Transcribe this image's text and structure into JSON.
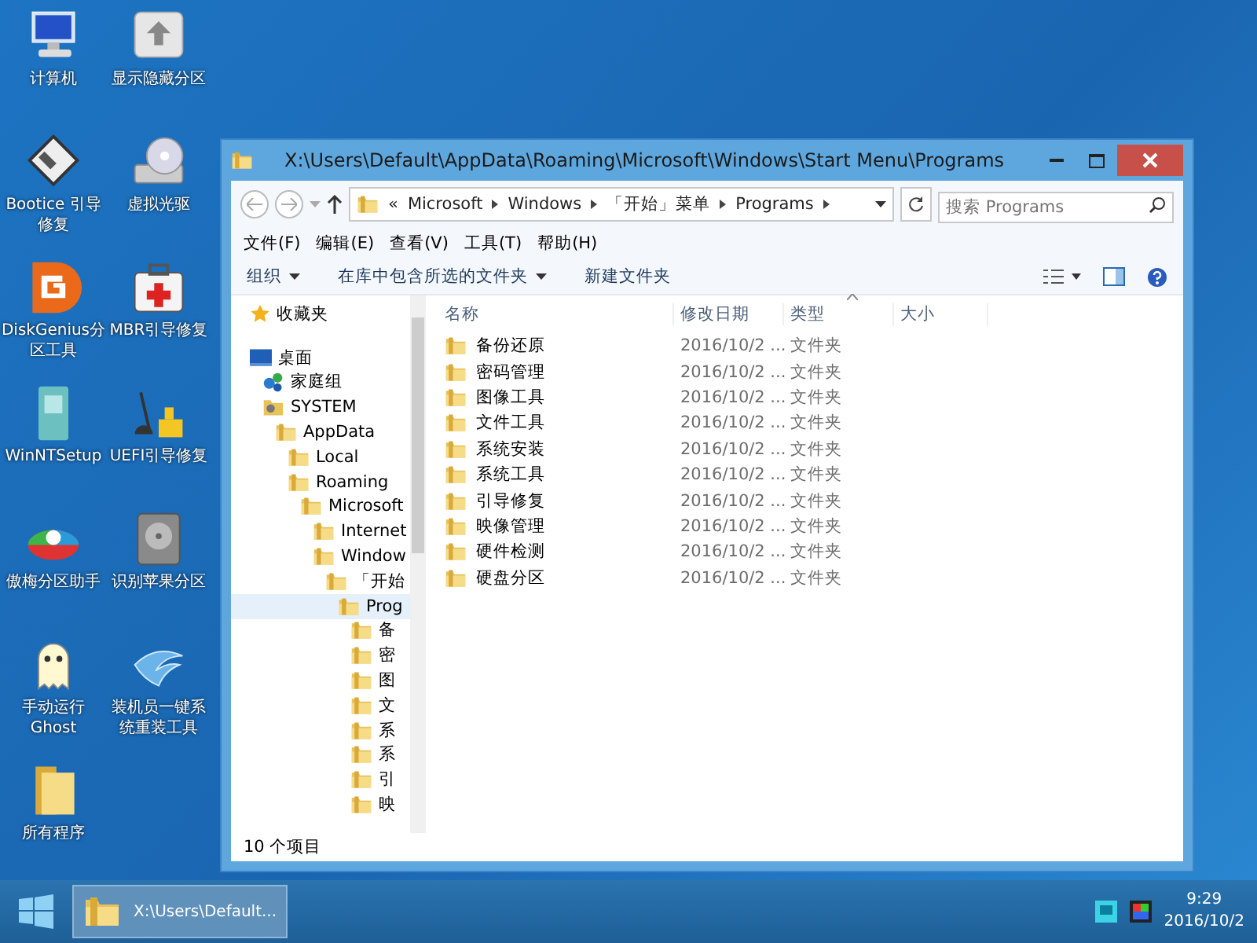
{
  "desktop_icons": [
    {
      "label": "计算机",
      "kind": "computer"
    },
    {
      "label": "显示隐藏分区",
      "kind": "unhide"
    },
    {
      "label": "Bootice 引导修复",
      "kind": "floppy"
    },
    {
      "label": "虚拟光驱",
      "kind": "optical"
    },
    {
      "label": "DiskGenius分区工具",
      "kind": "diskgenius"
    },
    {
      "label": "MBR引导修复",
      "kind": "firstaid"
    },
    {
      "label": "WinNTSetup",
      "kind": "setup"
    },
    {
      "label": "UEFI引导修复",
      "kind": "crane"
    },
    {
      "label": "傲梅分区助手",
      "kind": "partition"
    },
    {
      "label": "识别苹果分区",
      "kind": "harddisk"
    },
    {
      "label": "手动运行Ghost",
      "kind": "ghost"
    },
    {
      "label": "装机员一键系统重装工具",
      "kind": "bird"
    },
    {
      "label": "所有程序",
      "kind": "folder"
    }
  ],
  "window": {
    "title": "X:\\Users\\Default\\AppData\\Roaming\\Microsoft\\Windows\\Start Menu\\Programs",
    "address": {
      "overflow": "«",
      "segments": [
        "Microsoft",
        "Windows",
        "「开始」菜单",
        "Programs"
      ]
    },
    "search": {
      "placeholder": "搜索 Programs"
    },
    "menu": [
      "文件(F)",
      "编辑(E)",
      "查看(V)",
      "工具(T)",
      "帮助(H)"
    ],
    "toolbar": [
      {
        "label": "组织",
        "dropdown": true
      },
      {
        "label": "在库中包含所选的文件夹",
        "dropdown": true
      },
      {
        "label": "新建文件夹",
        "dropdown": false
      }
    ],
    "tree": [
      {
        "label": "收藏夹",
        "kind": "favorites",
        "selected": false
      },
      {
        "label": "桌面",
        "kind": "desktop",
        "selected": false,
        "children": [
          {
            "label": "家庭组",
            "kind": "homegroup",
            "selected": false
          },
          {
            "label": "SYSTEM",
            "kind": "user",
            "selected": false,
            "children": [
              {
                "label": "AppData",
                "kind": "folder",
                "selected": false,
                "children": [
                  {
                    "label": "Local",
                    "kind": "folder",
                    "selected": false
                  },
                  {
                    "label": "Roaming",
                    "kind": "folder",
                    "selected": false,
                    "children": [
                      {
                        "label": "Microsoft",
                        "kind": "folder",
                        "selected": false,
                        "children": [
                          {
                            "label": "Internet",
                            "kind": "folder",
                            "selected": false
                          },
                          {
                            "label": "Window",
                            "kind": "folder",
                            "selected": false,
                            "children": [
                              {
                                "label": "「开始",
                                "kind": "folder",
                                "selected": false,
                                "children": [
                                  {
                                    "label": "Prog",
                                    "kind": "folder",
                                    "selected": true,
                                    "children": [
                                      {
                                        "label": "备",
                                        "kind": "folder",
                                        "selected": false
                                      },
                                      {
                                        "label": "密",
                                        "kind": "folder",
                                        "selected": false
                                      },
                                      {
                                        "label": "图",
                                        "kind": "folder",
                                        "selected": false
                                      },
                                      {
                                        "label": "文",
                                        "kind": "folder",
                                        "selected": false
                                      },
                                      {
                                        "label": "系",
                                        "kind": "folder",
                                        "selected": false
                                      },
                                      {
                                        "label": "系",
                                        "kind": "folder",
                                        "selected": false
                                      },
                                      {
                                        "label": "引",
                                        "kind": "folder",
                                        "selected": false
                                      },
                                      {
                                        "label": "映",
                                        "kind": "folder",
                                        "selected": false
                                      }
                                    ]
                                  }
                                ]
                              }
                            ]
                          }
                        ]
                      }
                    ]
                  }
                ]
              }
            ]
          }
        ]
      }
    ],
    "columns": [
      "名称",
      "修改日期",
      "类型",
      "大小"
    ],
    "rows": [
      {
        "name": "备份还原",
        "date": "2016/10/2 ...",
        "type": "文件夹"
      },
      {
        "name": "密码管理",
        "date": "2016/10/2 ...",
        "type": "文件夹"
      },
      {
        "name": "图像工具",
        "date": "2016/10/2 ...",
        "type": "文件夹"
      },
      {
        "name": "文件工具",
        "date": "2016/10/2 ...",
        "type": "文件夹"
      },
      {
        "name": "系统安装",
        "date": "2016/10/2 ...",
        "type": "文件夹"
      },
      {
        "name": "系统工具",
        "date": "2016/10/2 ...",
        "type": "文件夹"
      },
      {
        "name": "引导修复",
        "date": "2016/10/2 ...",
        "type": "文件夹"
      },
      {
        "name": "映像管理",
        "date": "2016/10/2 ...",
        "type": "文件夹"
      },
      {
        "name": "硬件检测",
        "date": "2016/10/2 ...",
        "type": "文件夹"
      },
      {
        "name": "硬盘分区",
        "date": "2016/10/2 ...",
        "type": "文件夹"
      }
    ],
    "status": "10 个项目"
  },
  "taskbar": {
    "task": "X:\\Users\\Default...",
    "time": "9:29",
    "date": "2016/10/2"
  }
}
